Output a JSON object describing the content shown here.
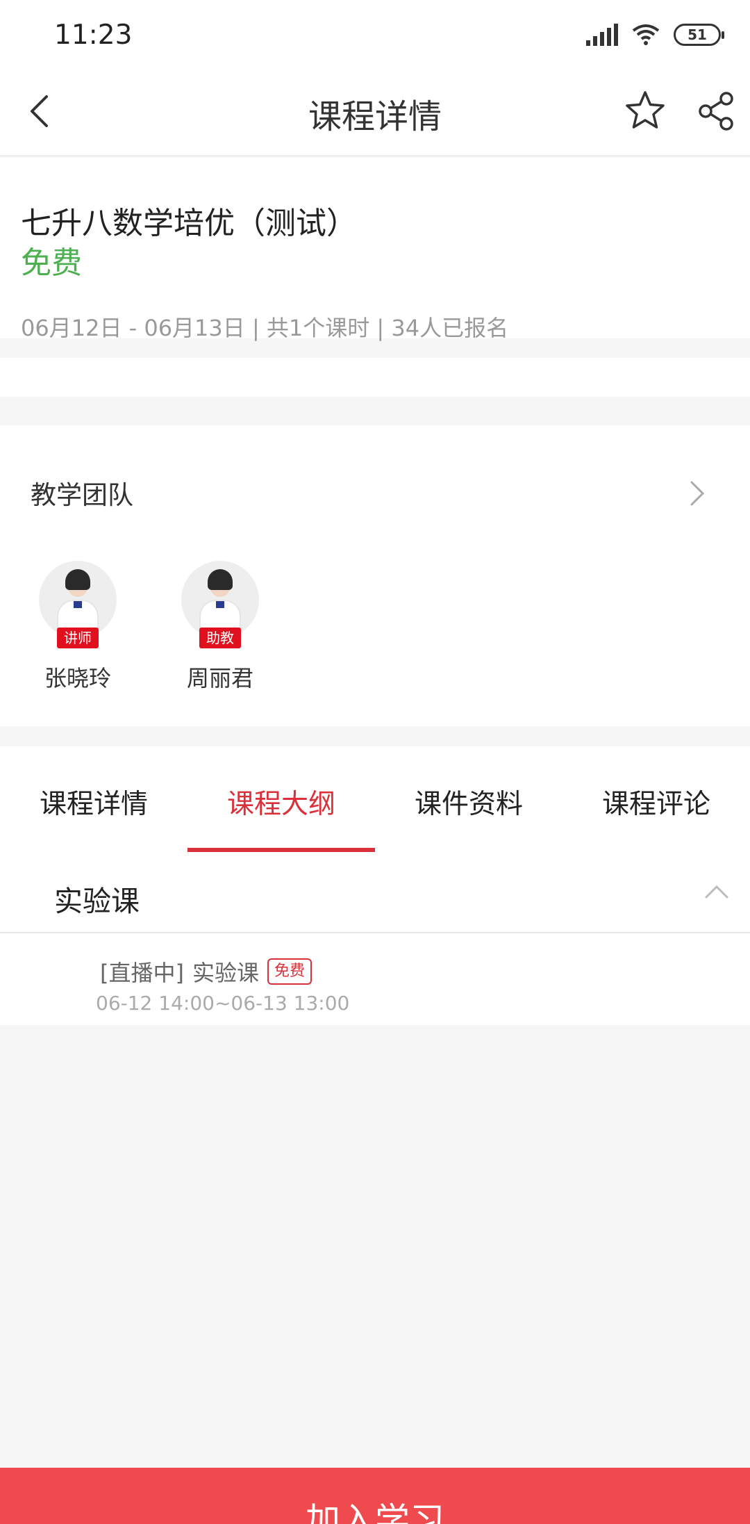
{
  "status_bar": {
    "time": "11:23",
    "battery": "51"
  },
  "header": {
    "title": "课程详情"
  },
  "course": {
    "title": "七升八数学培优（测试）",
    "price": "免费",
    "meta": "06月12日 - 06月13日 | 共1个课时 | 34人已报名"
  },
  "team": {
    "title": "教学团队",
    "members": [
      {
        "name": "张晓玲",
        "role": "讲师"
      },
      {
        "name": "周丽君",
        "role": "助教"
      }
    ]
  },
  "tabs": [
    {
      "label": "课程详情"
    },
    {
      "label": "课程大纲"
    },
    {
      "label": "课件资料"
    },
    {
      "label": "课程评论"
    }
  ],
  "active_tab": "课程大纲",
  "outline": {
    "chapter": "实验课",
    "lesson": {
      "status": "[直播中]",
      "name": "实验课",
      "tag": "免费",
      "time": "06-12 14:00~06-13 13:00"
    }
  },
  "cta": {
    "label": "加入学习"
  },
  "colors": {
    "accent": "#d9303a",
    "cta_bg": "#ef4b4e",
    "price": "#4caf50",
    "badge": "#e1101e"
  },
  "icons": [
    "back-icon",
    "star-icon",
    "share-icon",
    "chevron-right-icon",
    "chevron-up-icon",
    "signal-icon",
    "wifi-icon",
    "battery-icon"
  ]
}
